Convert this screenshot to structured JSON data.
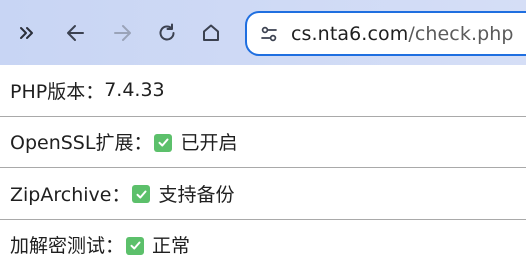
{
  "browser": {
    "url_host": "cs.nta6.com",
    "url_path": "/check.php",
    "icons": [
      "chevrons-right-icon",
      "back-arrow-icon",
      "forward-arrow-icon",
      "reload-icon",
      "home-icon",
      "site-info-icon"
    ]
  },
  "page": {
    "rows": [
      {
        "label": "PHP版本：",
        "value": "7.4.33",
        "status_icon": null
      },
      {
        "label": "OpenSSL扩展：",
        "value": "已开启",
        "status_icon": "green-check-icon"
      },
      {
        "label": "ZipArchive：",
        "value": "支持备份",
        "status_icon": "green-check-icon"
      },
      {
        "label": "加解密测试：",
        "value": "正常",
        "status_icon": "green-check-icon"
      }
    ]
  },
  "colors": {
    "toolbar_bg": "#d0daf5",
    "omnibox_border": "#1f6fe0",
    "check_green": "#5cc06b",
    "divider": "#a9a9a9"
  }
}
